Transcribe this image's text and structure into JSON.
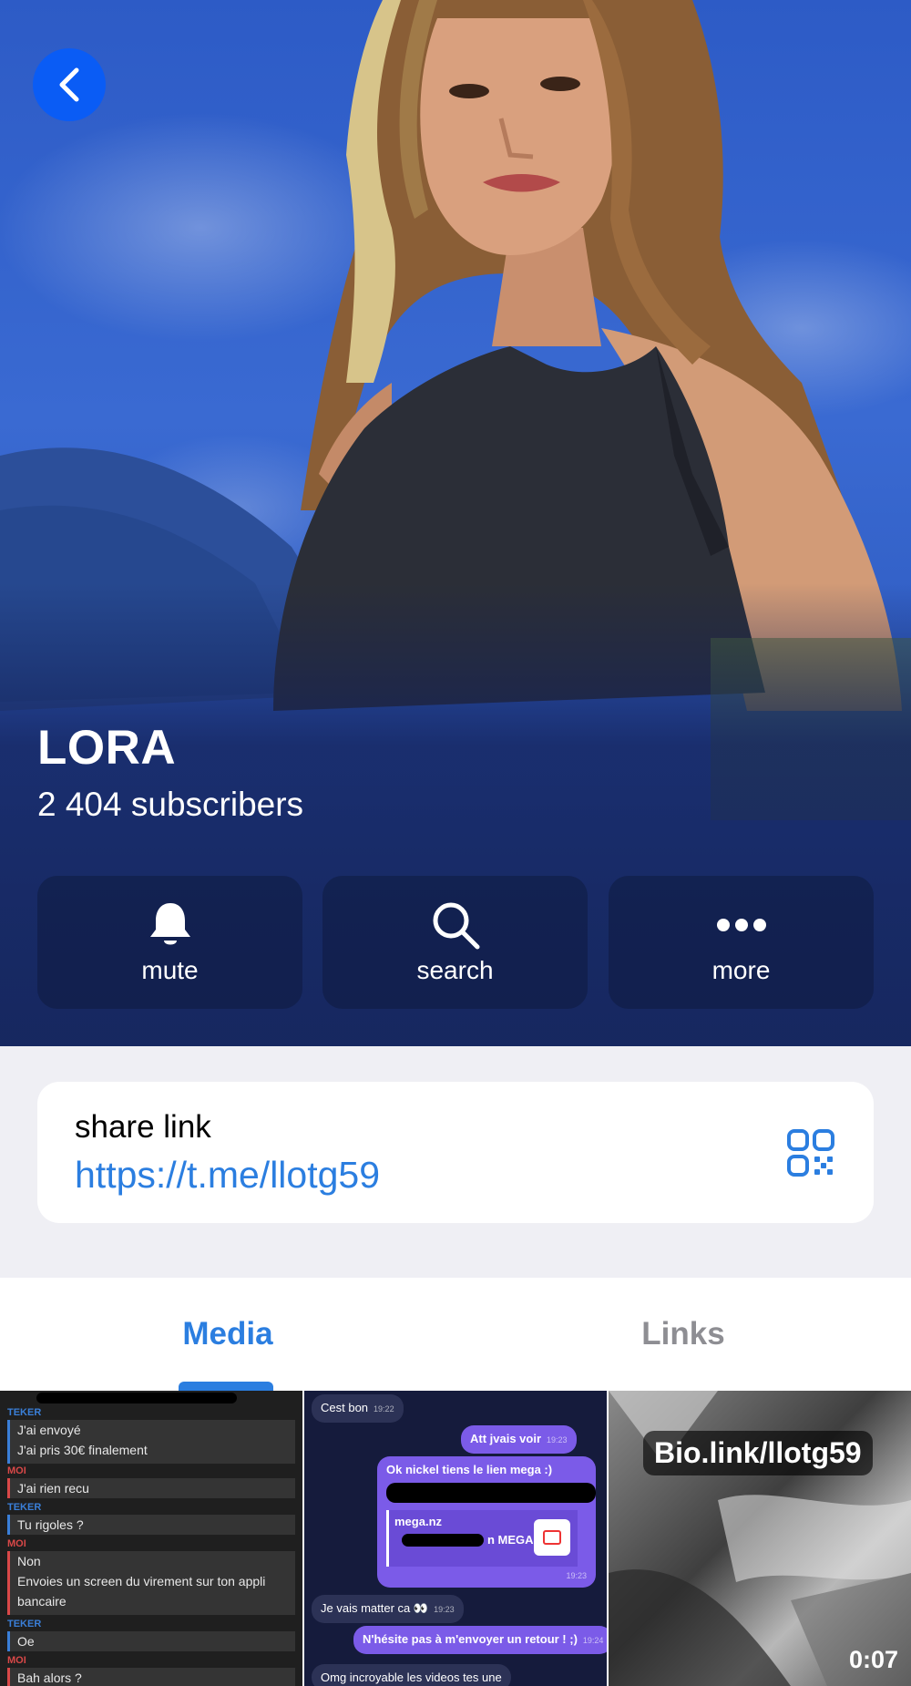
{
  "header": {
    "back_icon": "chevron-left-icon",
    "name": "LORA",
    "subscribers": "2 404 subscribers",
    "accent_color": "#0a5cf5"
  },
  "actions": [
    {
      "label": "mute",
      "icon": "bell-icon"
    },
    {
      "label": "search",
      "icon": "search-icon"
    },
    {
      "label": "more",
      "icon": "more-dots-icon"
    }
  ],
  "share": {
    "title": "share link",
    "url": "https://t.me/llotg59",
    "qr_icon": "qr-code-icon",
    "link_color": "#2b7ee0"
  },
  "tabs": [
    {
      "label": "Media",
      "active": true
    },
    {
      "label": "Links",
      "active": false
    }
  ],
  "media": {
    "chat_log": {
      "lines": [
        {
          "tag": "TEKER",
          "text": "J'ai envoyé\nJ'ai pris 30€ finalement"
        },
        {
          "tag": "MOI",
          "text": "J'ai rien recu"
        },
        {
          "tag": "TEKER",
          "text": "Tu rigoles ?"
        },
        {
          "tag": "MOI",
          "text": "Non\nEnvoies un screen du virement sur ton appli bancaire"
        },
        {
          "tag": "TEKER",
          "text": "Oe"
        },
        {
          "tag": "MOI",
          "text": "Bah alors ?"
        }
      ]
    },
    "chat_screen": {
      "messages": [
        {
          "dir": "in",
          "text": "Cest bon",
          "time": "19:22"
        },
        {
          "dir": "out",
          "text": "Att jvais voir",
          "time": "19:23"
        },
        {
          "dir": "out",
          "text": "Ok nickel tiens le lien mega :)",
          "time": ""
        },
        {
          "dir": "out",
          "text": "mega.nz",
          "time": ""
        },
        {
          "dir": "out",
          "text": "n MEGA",
          "time": "19:23"
        },
        {
          "dir": "in",
          "text": "Je vais matter ca 👀",
          "time": "19:23"
        },
        {
          "dir": "out",
          "text": "N'hésite pas à m'envoyer un retour ! ;)",
          "time": "19:24"
        },
        {
          "dir": "in",
          "text": "Omg incroyable les videos tes une",
          "time": ""
        }
      ]
    },
    "video": {
      "overlay_text": "Bio.link/llotg59",
      "duration": "0:07"
    }
  }
}
